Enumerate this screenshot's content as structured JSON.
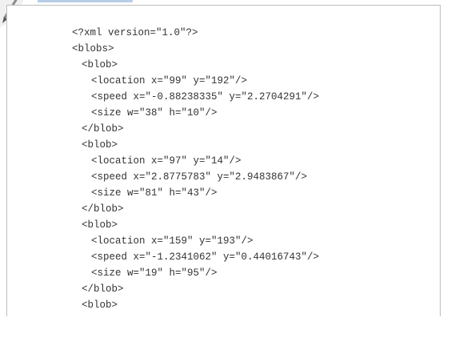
{
  "top_tab": {
    "color": "#b8cde6"
  },
  "corner_icon": {
    "name": "pencil-icon"
  },
  "code": {
    "lines": [
      {
        "text": "<?xml version=\"1.0\"?>",
        "indent": 0
      },
      {
        "text": "<blobs>",
        "indent": 0
      },
      {
        "text": "<blob>",
        "indent": 1
      },
      {
        "text": "<location x=\"99\" y=\"192\"/>",
        "indent": 2
      },
      {
        "text": "<speed x=\"-0.88238335\" y=\"2.2704291\"/>",
        "indent": 2
      },
      {
        "text": "<size w=\"38\" h=\"10\"/>",
        "indent": 2
      },
      {
        "text": "</blob>",
        "indent": 1
      },
      {
        "text": "<blob>",
        "indent": 1
      },
      {
        "text": "<location x=\"97\" y=\"14\"/>",
        "indent": 2
      },
      {
        "text": "<speed x=\"2.8775783\" y=\"2.9483867\"/>",
        "indent": 2
      },
      {
        "text": "<size w=\"81\" h=\"43\"/>",
        "indent": 2
      },
      {
        "text": "</blob>",
        "indent": 1
      },
      {
        "text": "<blob>",
        "indent": 1
      },
      {
        "text": "<location x=\"159\" y=\"193\"/>",
        "indent": 2
      },
      {
        "text": "<speed x=\"-1.2341062\" y=\"0.44016743\"/>",
        "indent": 2
      },
      {
        "text": "<size w=\"19\" h=\"95\"/>",
        "indent": 2
      },
      {
        "text": "</blob>",
        "indent": 1
      },
      {
        "text": "<blob>",
        "indent": 1
      }
    ]
  }
}
